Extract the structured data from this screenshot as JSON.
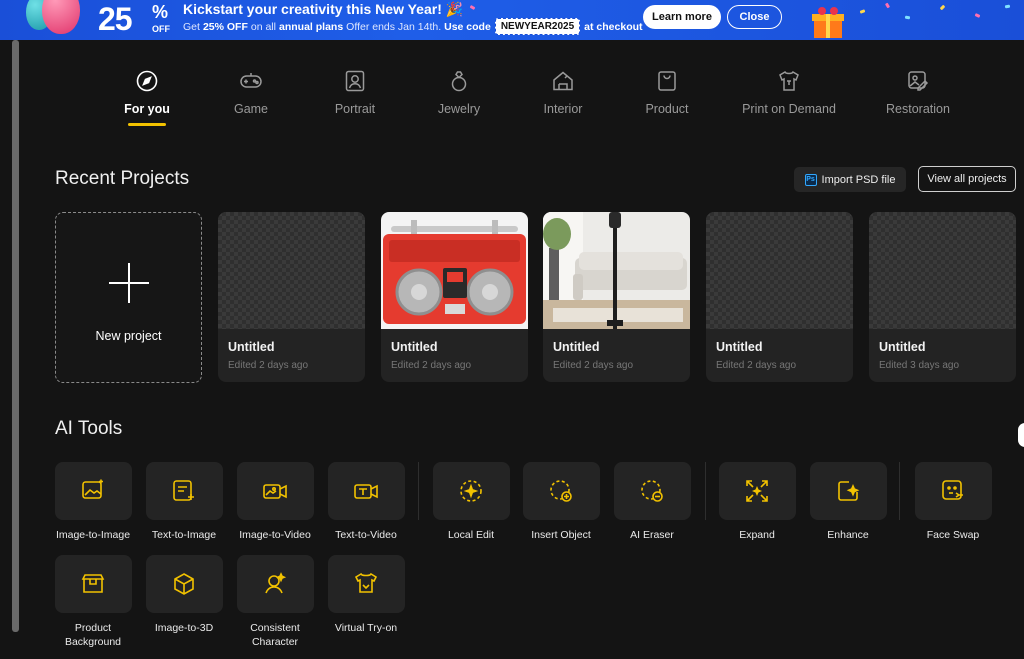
{
  "banner": {
    "percent": "25",
    "percent_sign": "%",
    "off": "OFF",
    "title": "Kickstart your creativity this New Year! 🎉",
    "line_prefix": "Get",
    "discount": "25% OFF",
    "line_mid": "on all",
    "plans": "annual plans",
    "offer_ends": "Offer ends Jan 14th.",
    "use_code": "Use code",
    "code": "NEWYEAR2025",
    "at_checkout": "at checkout",
    "learn_more": "Learn more",
    "close": "Close"
  },
  "tabs": [
    {
      "label": "For you",
      "icon": "compass-icon",
      "active": true
    },
    {
      "label": "Game",
      "icon": "gamepad-icon"
    },
    {
      "label": "Portrait",
      "icon": "portrait-icon"
    },
    {
      "label": "Jewelry",
      "icon": "ring-icon"
    },
    {
      "label": "Interior",
      "icon": "house-icon"
    },
    {
      "label": "Product",
      "icon": "bag-icon"
    },
    {
      "label": "Print on Demand",
      "icon": "tshirt-icon"
    },
    {
      "label": "Restoration",
      "icon": "photo-restore-icon"
    }
  ],
  "recent": {
    "title": "Recent Projects",
    "import_label": "Import PSD file",
    "ps_badge": "Ps",
    "view_all": "View all projects",
    "new_project": "New project",
    "projects": [
      {
        "title": "Untitled",
        "edited": "Edited 2 days ago",
        "thumb": "transparent"
      },
      {
        "title": "Untitled",
        "edited": "Edited 2 days ago",
        "thumb": "red-boombox"
      },
      {
        "title": "Untitled",
        "edited": "Edited 2 days ago",
        "thumb": "living-room"
      },
      {
        "title": "Untitled",
        "edited": "Edited 2 days ago",
        "thumb": "transparent"
      },
      {
        "title": "Untitled",
        "edited": "Edited 3 days ago",
        "thumb": "transparent"
      }
    ]
  },
  "ai_tools": {
    "title": "AI Tools",
    "tools": [
      {
        "label": "Image-to-Image",
        "icon": "image-sparkle-icon"
      },
      {
        "label": "Text-to-Image",
        "icon": "text-sparkle-icon"
      },
      {
        "label": "Image-to-Video",
        "icon": "image-video-icon"
      },
      {
        "label": "Text-to-Video",
        "icon": "text-video-icon"
      },
      {
        "label": "Local Edit",
        "icon": "local-edit-icon"
      },
      {
        "label": "Insert Object",
        "icon": "insert-object-icon"
      },
      {
        "label": "AI Eraser",
        "icon": "eraser-icon"
      },
      {
        "label": "Expand",
        "icon": "expand-icon"
      },
      {
        "label": "Enhance",
        "icon": "enhance-icon"
      },
      {
        "label": "Face Swap",
        "icon": "face-swap-icon"
      },
      {
        "label": "Product Background",
        "icon": "product-bg-icon"
      },
      {
        "label": "Image-to-3D",
        "icon": "cube-icon"
      },
      {
        "label": "Consistent Character",
        "icon": "character-icon"
      },
      {
        "label": "Virtual Try-on",
        "icon": "try-on-icon"
      }
    ]
  },
  "colors": {
    "accent": "#f2c200",
    "background": "#141414",
    "banner": "#1a4fd8"
  }
}
